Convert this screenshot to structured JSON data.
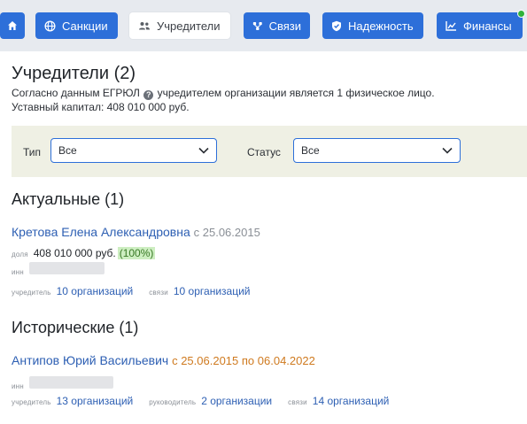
{
  "nav": {
    "items": [
      {
        "label": "Санкции"
      },
      {
        "label": "Учредители"
      },
      {
        "label": "Связи"
      },
      {
        "label": "Надежность"
      },
      {
        "label": "Финансы"
      }
    ],
    "colors": {
      "primary": "#2d6fd9",
      "online": "#31b23b"
    }
  },
  "page": {
    "title": "Учредители (2)",
    "desc_prefix": "Согласно данным ЕГРЮЛ",
    "desc_suffix": "учредителем организации является 1 физическое лицо.",
    "capital": "Уставный капитал: 408 010 000 руб."
  },
  "filters": {
    "type_label": "Тип",
    "type_value": "Все",
    "status_label": "Статус",
    "status_value": "Все"
  },
  "current": {
    "title": "Актуальные (1)",
    "person": {
      "name": "Кретова Елена Александровна",
      "since": "с 25.06.2015",
      "share_label": "доля",
      "share_value": "408 010 000 руб.",
      "share_percent": "(100%)",
      "inn_label": "инн",
      "founder_label": "учредитель",
      "founder_link": "10 организаций",
      "links_label": "связи",
      "links_link": "10 организаций"
    }
  },
  "historical": {
    "title": "Исторические (1)",
    "person": {
      "name": "Антипов Юрий Васильевич",
      "period": "с 25.06.2015 по 06.04.2022",
      "inn_label": "инн",
      "founder_label": "учредитель",
      "founder_link": "13 организаций",
      "head_label": "руководитель",
      "head_link": "2 организации",
      "links_label": "связи",
      "links_link": "14 организаций"
    }
  }
}
